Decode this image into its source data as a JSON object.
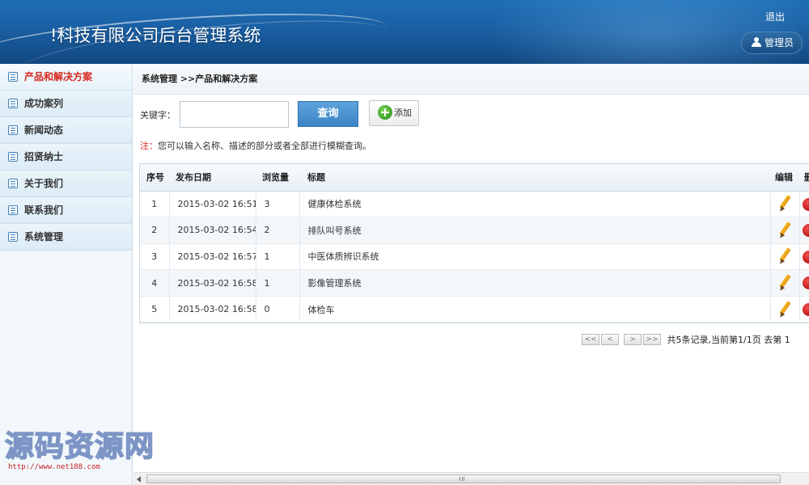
{
  "header": {
    "title": "!科技有限公司后台管理系统",
    "logout_label": "退出",
    "user_label": "管理员"
  },
  "sidebar": {
    "items": [
      {
        "label": "产品和解决方案",
        "active": true
      },
      {
        "label": "成功案列"
      },
      {
        "label": "新闻动态"
      },
      {
        "label": "招贤纳士"
      },
      {
        "label": "关于我们"
      },
      {
        "label": "联系我们"
      },
      {
        "label": "系统管理"
      }
    ]
  },
  "breadcrumb": "系统管理 >>产品和解决方案",
  "search": {
    "label": "关键字：",
    "value": "",
    "query_button": "查询",
    "add_button": "添加"
  },
  "note": {
    "mark": "注：",
    "text": "您可以输入名称、描述的部分或者全部进行模糊查询。"
  },
  "table": {
    "headers": {
      "no": "序号",
      "date": "发布日期",
      "views": "浏览量",
      "title": "标题",
      "edit": "编辑",
      "del": "删"
    },
    "rows": [
      {
        "no": "1",
        "date": "2015-03-02 16:51",
        "views": "3",
        "title": "健康体检系统"
      },
      {
        "no": "2",
        "date": "2015-03-02 16:54",
        "views": "2",
        "title": "排队叫号系统"
      },
      {
        "no": "3",
        "date": "2015-03-02 16:57",
        "views": "1",
        "title": "中医体质辨识系统"
      },
      {
        "no": "4",
        "date": "2015-03-02 16:58",
        "views": "1",
        "title": "影像管理系统"
      },
      {
        "no": "5",
        "date": "2015-03-02 16:58",
        "views": "0",
        "title": "体检车"
      }
    ]
  },
  "pager": {
    "first": "<<",
    "prev": "<",
    "next": ">",
    "last": ">>",
    "summary": "共5条记录,当前第1/1页 去第 1"
  },
  "watermark": {
    "main": "源码资源网",
    "url": "http://www.net188.com"
  },
  "colors": {
    "header_bg": "#1a5fa3",
    "active_nav": "#d8261c",
    "query_button": "#3b83c4"
  }
}
